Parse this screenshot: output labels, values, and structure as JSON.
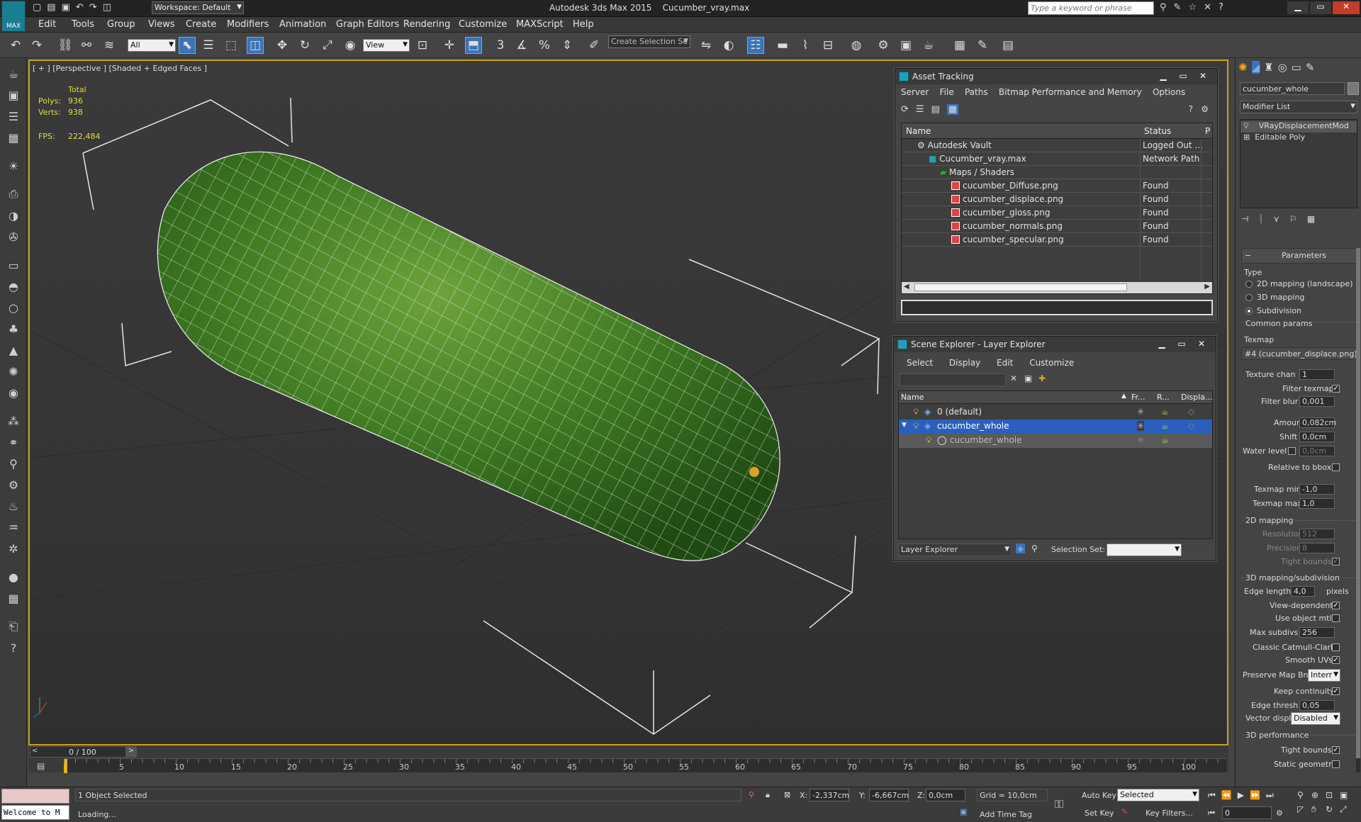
{
  "app": {
    "title": "Autodesk 3ds Max 2015",
    "file": "Cucumber_vray.max",
    "workspace": "Workspace: Default",
    "search_placeholder": "Type a keyword or phrase",
    "logo_text": "MAX"
  },
  "menu": [
    "Edit",
    "Tools",
    "Group",
    "Views",
    "Create",
    "Modifiers",
    "Animation",
    "Graph Editors",
    "Rendering",
    "Customize",
    "MAXScript",
    "Help"
  ],
  "toolbar": {
    "filter": "All",
    "ref_coord": "View",
    "selection_set": "Create Selection Se",
    "snap_3": "3",
    "pct": "%"
  },
  "viewport": {
    "label": "[ + ] [Perspective ] [Shaded + Edged Faces ]",
    "stats_total": "Total",
    "polys_label": "Polys:",
    "polys": "936",
    "verts_label": "Verts:",
    "verts": "938",
    "fps_label": "FPS:",
    "fps": "222,484"
  },
  "asset_tracking": {
    "title": "Asset Tracking",
    "menu": [
      "Server",
      "File",
      "Paths",
      "Bitmap Performance and Memory",
      "Options"
    ],
    "col_name": "Name",
    "col_status": "Status",
    "col_p": "P",
    "rows": [
      {
        "name": "Autodesk Vault",
        "status": "Logged Out ..."
      },
      {
        "name": "Cucumber_vray.max",
        "status": "Network Path"
      },
      {
        "name": "Maps / Shaders",
        "status": ""
      },
      {
        "name": "cucumber_Diffuse.png",
        "status": "Found"
      },
      {
        "name": "cucumber_displace.png",
        "status": "Found"
      },
      {
        "name": "cucumber_gloss.png",
        "status": "Found"
      },
      {
        "name": "cucumber_normals.png",
        "status": "Found"
      },
      {
        "name": "cucumber_specular.png",
        "status": "Found"
      }
    ]
  },
  "scene_explorer": {
    "title": "Scene Explorer - Layer Explorer",
    "menu": [
      "Select",
      "Display",
      "Edit",
      "Customize"
    ],
    "col_name": "Name",
    "col_fr": "Fr...",
    "col_r": "R...",
    "col_disp": "Displa...",
    "rows": [
      {
        "name": "0 (default)"
      },
      {
        "name": "cucumber_whole"
      },
      {
        "name": "cucumber_whole"
      }
    ],
    "footer_mode": "Layer Explorer",
    "selection_set_label": "Selection Set:"
  },
  "command_panel": {
    "object_name": "cucumber_whole",
    "modifier_list": "Modifier List",
    "stack": [
      "VRayDisplacementMod",
      "Editable Poly"
    ],
    "parameters_title": "Parameters",
    "type_label": "Type",
    "type_options": [
      "2D mapping (landscape)",
      "3D mapping",
      "Subdivision"
    ],
    "common_params": "Common params",
    "texmap_label": "Texmap",
    "texmap_value": "#4 (cucumber_displace.png)",
    "texture_chan_label": "Texture chan",
    "texture_chan": "1",
    "filter_texmap_label": "Filter texmap",
    "filter_blur_label": "Filter blur",
    "filter_blur": "0,001",
    "amount_label": "Amount",
    "amount": "0,082cm",
    "shift_label": "Shift",
    "shift": "0,0cm",
    "water_level_label": "Water level",
    "water_level": "0,0cm",
    "relative_bbox_label": "Relative to bbox",
    "texmap_min_label": "Texmap min",
    "texmap_min": "-1,0",
    "texmap_max_label": "Texmap max",
    "texmap_max": "1,0",
    "mapping2d_title": "2D mapping",
    "resolution_label": "Resolution",
    "resolution": "512",
    "precision_label": "Precision",
    "precision": "8",
    "tight_bounds_label": "Tight bounds",
    "mapping3d_title": "3D mapping/subdivision",
    "edge_length_label": "Edge length",
    "edge_length": "4,0",
    "pixels_label": "pixels",
    "view_dependent_label": "View-dependent",
    "use_object_mtl_label": "Use object mtl",
    "max_subdivs_label": "Max subdivs",
    "max_subdivs": "256",
    "classic_cc_label": "Classic Catmull-Clark",
    "smooth_uvs_label": "Smooth UVs",
    "preserve_map_label": "Preserve Map Bnd",
    "preserve_map_value": "Interr",
    "keep_continuity_label": "Keep continuity",
    "edge_thresh_label": "Edge thresh",
    "edge_thresh": "0,05",
    "vector_displ_label": "Vector displ",
    "vector_displ_value": "Disabled",
    "perf_title": "3D performance",
    "perf_tight_bounds_label": "Tight bounds",
    "static_geometry_label": "Static geometry"
  },
  "timeline": {
    "frame": "0 / 100",
    "ticks": [
      "5",
      "10",
      "15",
      "20",
      "25",
      "30",
      "35",
      "40",
      "45",
      "50",
      "55",
      "60",
      "65",
      "70",
      "75",
      "80",
      "85",
      "90",
      "95",
      "100"
    ]
  },
  "status": {
    "script_text": "Welcome to M",
    "selected": "1 Object Selected",
    "loading": "Loading...",
    "x_label": "X:",
    "x": "-2,337cm",
    "y_label": "Y:",
    "y": "-6,667cm",
    "z_label": "Z:",
    "z": "0,0cm",
    "grid": "Grid = 10,0cm",
    "add_time_tag": "Add Time Tag",
    "auto_key": "Auto Key",
    "set_key": "Set Key",
    "key_mode": "Selected",
    "key_filters": "Key Filters...",
    "current_frame": "0"
  }
}
